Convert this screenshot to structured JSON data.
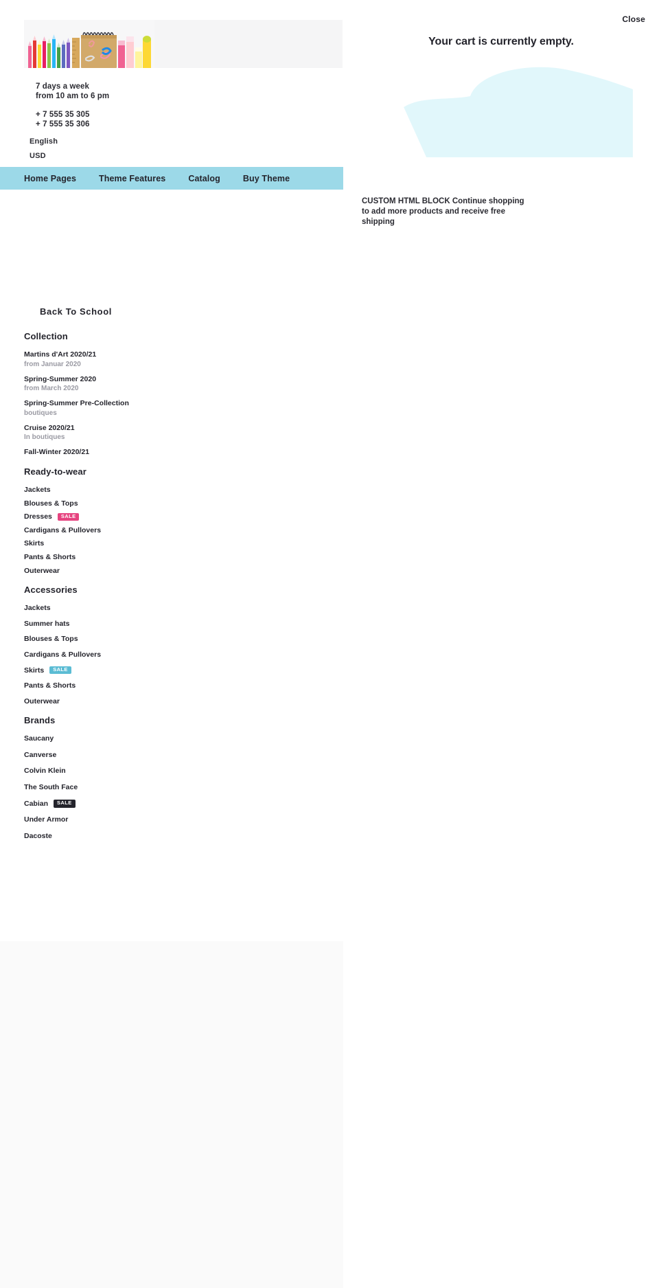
{
  "colors": {
    "nav_bar": "#9cd9e8",
    "badge_pink": "#e6437f",
    "badge_blue": "#5bbcd4",
    "badge_dark": "#24242c",
    "blob": "#e1f7fb",
    "panel_gray": "#fafafa",
    "banner_gray": "#f5f5f6",
    "text": "#24242c",
    "muted": "#9a9aa3"
  },
  "promo": {
    "banner_alt": "back-to-school-supplies-banner",
    "tile_label": "Back To School"
  },
  "contact": {
    "hours_line_1": "7 days a week",
    "hours_line_2": "from 10 am to 6 pm",
    "phone_1": "+ 7 555 35 305",
    "phone_2": "+ 7 555 35 306"
  },
  "locale": {
    "language": "English",
    "currency": "USD"
  },
  "main_nav": {
    "items": [
      {
        "label": "Home Pages"
      },
      {
        "label": "Theme Features"
      },
      {
        "label": "Catalog"
      },
      {
        "label": "Buy Theme"
      }
    ]
  },
  "mega_menu": {
    "collection": {
      "heading": "Collection",
      "items": [
        {
          "label": "Martins d'Art 2020/21",
          "sub": "from Januar 2020"
        },
        {
          "label": "Spring-Summer 2020",
          "sub": "from March 2020"
        },
        {
          "label": "Spring-Summer Pre-Collection",
          "sub": "boutiques"
        },
        {
          "label": "Cruise 2020/21",
          "sub": "In boutiques"
        },
        {
          "label": "Fall-Winter 2020/21",
          "sub": ""
        }
      ]
    },
    "ready_to_wear": {
      "heading": "Ready-to-wear",
      "items": [
        {
          "label": "Jackets",
          "badge": ""
        },
        {
          "label": "Blouses & Tops",
          "badge": ""
        },
        {
          "label": "Dresses",
          "badge": "SALE",
          "badge_style": "pink"
        },
        {
          "label": "Cardigans & Pullovers",
          "badge": ""
        },
        {
          "label": "Skirts",
          "badge": ""
        },
        {
          "label": "Pants & Shorts",
          "badge": ""
        },
        {
          "label": "Outerwear",
          "badge": ""
        }
      ]
    },
    "accessories": {
      "heading": "Accessories",
      "items": [
        {
          "label": "Jackets",
          "badge": ""
        },
        {
          "label": "Summer hats",
          "badge": ""
        },
        {
          "label": "Blouses & Tops",
          "badge": ""
        },
        {
          "label": "Cardigans & Pullovers",
          "badge": ""
        },
        {
          "label": "Skirts",
          "badge": "SALE",
          "badge_style": "blue"
        },
        {
          "label": "Pants & Shorts",
          "badge": ""
        },
        {
          "label": "Outerwear",
          "badge": ""
        }
      ]
    },
    "brands": {
      "heading": "Brands",
      "items": [
        {
          "label": "Saucany",
          "badge": ""
        },
        {
          "label": "Canverse",
          "badge": ""
        },
        {
          "label": "Colvin Klein",
          "badge": ""
        },
        {
          "label": "The South Face",
          "badge": ""
        },
        {
          "label": "Cabian",
          "badge": "SALE",
          "badge_style": "dark"
        },
        {
          "label": "Under Armor",
          "badge": ""
        },
        {
          "label": "Dacoste",
          "badge": ""
        }
      ]
    }
  },
  "cart": {
    "close_label": "Close",
    "empty_title": "Your cart is currently empty.",
    "blob_name": "empty-cart-illustration",
    "note": "CUSTOM HTML BLOCK Continue shopping to add more products and receive free shipping"
  }
}
